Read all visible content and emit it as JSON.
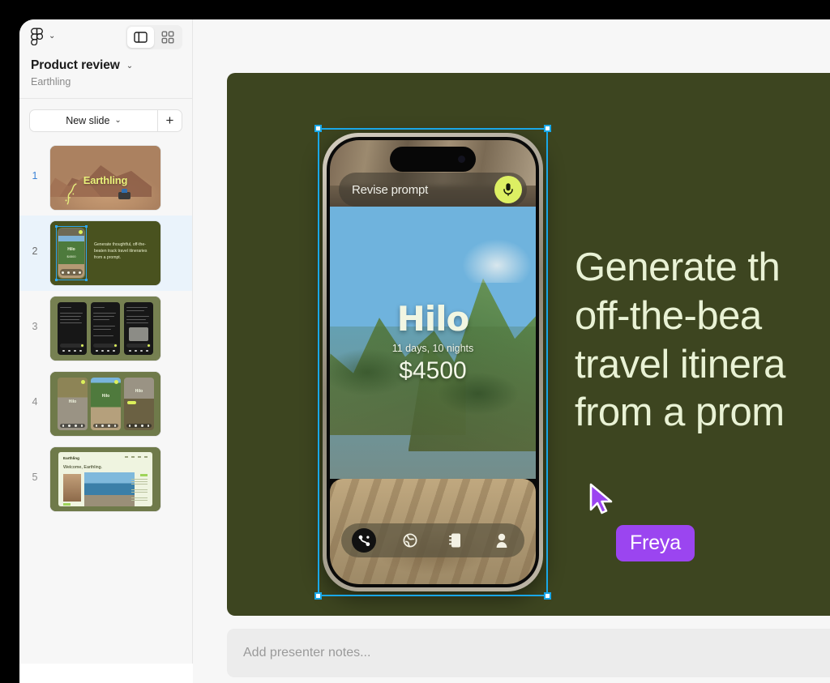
{
  "app": {
    "logo_icon": "figma-logo-icon",
    "logo_caret": "⌄",
    "view_toggle": [
      {
        "icon": "panel-layout-icon",
        "active": true
      },
      {
        "icon": "grid-layout-icon",
        "active": false
      }
    ]
  },
  "sidebar": {
    "title": "Product review",
    "title_caret": "⌄",
    "subtitle": "Earthling",
    "new_slide_label": "New slide",
    "new_slide_caret": "⌄",
    "add_label": "+",
    "slides": [
      {
        "number": "1",
        "title": "Earthling",
        "selected": false
      },
      {
        "number": "2",
        "body": "Generate thoughtful, off-the-beaten track travel itineraries from a prompt.",
        "selected": true
      },
      {
        "number": "3",
        "selected": false
      },
      {
        "number": "4",
        "selected": false
      },
      {
        "number": "5",
        "brand": "Earthling",
        "heading": "Welcome, Earthling.",
        "selected": false
      }
    ]
  },
  "slide": {
    "background_color": "#3d4520",
    "heading_lines": [
      "Generate th",
      "off-the-bea",
      "travel itinera",
      "from a prom"
    ],
    "phone": {
      "prompt_placeholder": "Revise prompt",
      "mic_icon": "microphone-icon",
      "mic_color": "#ddf063",
      "destination": "Hilo",
      "duration": "11 days, 10 nights",
      "price": "$4500",
      "nav_items": [
        {
          "icon": "compass-route-icon",
          "active": true
        },
        {
          "icon": "globe-icon",
          "active": false
        },
        {
          "icon": "notebook-icon",
          "active": false
        },
        {
          "icon": "profile-icon",
          "active": false
        }
      ]
    },
    "selection_color": "#19a7e8",
    "collaborator": {
      "name": "Freya",
      "color": "#9b45f0"
    }
  },
  "notes": {
    "placeholder": "Add presenter notes..."
  }
}
